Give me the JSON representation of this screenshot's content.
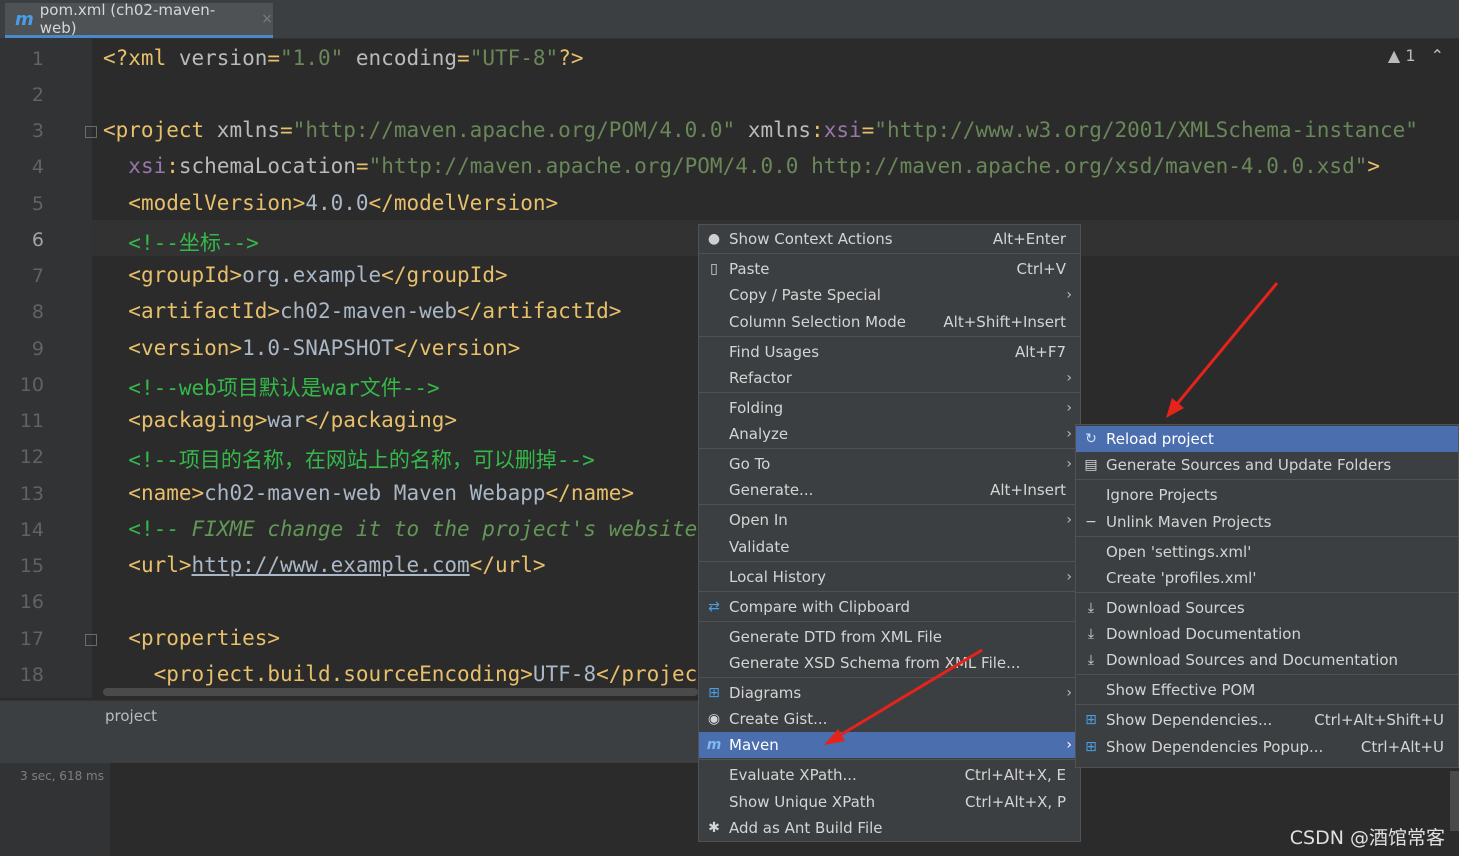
{
  "tab": {
    "title": "pom.xml (ch02-maven-web)",
    "icon": "maven-icon",
    "close": "×"
  },
  "editor": {
    "warning_count": "1",
    "line_numbers": [
      "1",
      "2",
      "3",
      "4",
      "5",
      "6",
      "7",
      "8",
      "9",
      "10",
      "11",
      "12",
      "13",
      "14",
      "15",
      "16",
      "17",
      "18"
    ],
    "current_line": "6"
  },
  "breadcrumb": "project",
  "bottom_panel": {
    "time": "3 sec, 618 ms"
  },
  "context_menu": {
    "show_context_actions": "Show Context Actions",
    "show_context_actions_sc": "Alt+Enter",
    "paste": "Paste",
    "paste_sc": "Ctrl+V",
    "copy_paste_special": "Copy / Paste Special",
    "column_selection_mode": "Column Selection Mode",
    "column_selection_mode_sc": "Alt+Shift+Insert",
    "find_usages": "Find Usages",
    "find_usages_sc": "Alt+F7",
    "refactor": "Refactor",
    "folding": "Folding",
    "analyze": "Analyze",
    "go_to": "Go To",
    "generate": "Generate...",
    "generate_sc": "Alt+Insert",
    "open_in": "Open In",
    "validate": "Validate",
    "local_history": "Local History",
    "compare_with_clipboard": "Compare with Clipboard",
    "generate_dtd": "Generate DTD from XML File",
    "generate_xsd": "Generate XSD Schema from XML File...",
    "diagrams": "Diagrams",
    "create_gist": "Create Gist...",
    "maven": "Maven",
    "evaluate_xpath": "Evaluate XPath...",
    "evaluate_xpath_sc": "Ctrl+Alt+X, E",
    "show_unique_xpath": "Show Unique XPath",
    "show_unique_xpath_sc": "Ctrl+Alt+X, P",
    "add_as_ant": "Add as Ant Build File"
  },
  "maven_submenu": {
    "reload_project": "Reload project",
    "generate_sources": "Generate Sources and Update Folders",
    "ignore_projects": "Ignore Projects",
    "unlink_maven_projects": "Unlink Maven Projects",
    "open_settings": "Open 'settings.xml'",
    "create_profiles": "Create 'profiles.xml'",
    "download_sources": "Download Sources",
    "download_documentation": "Download Documentation",
    "download_sources_docs": "Download Sources and Documentation",
    "show_effective_pom": "Show Effective POM",
    "show_dependencies": "Show Dependencies...",
    "show_dependencies_sc": "Ctrl+Alt+Shift+U",
    "show_dependencies_popup": "Show Dependencies Popup...",
    "show_dependencies_popup_sc": "Ctrl+Alt+U"
  },
  "watermark": "CSDN @酒馆常客",
  "colors": {
    "selection": "#4b6eaf",
    "arrow": "#e5231b",
    "tag": "#e8bf6a",
    "string": "#6a8759",
    "comment": "#34b84a"
  }
}
